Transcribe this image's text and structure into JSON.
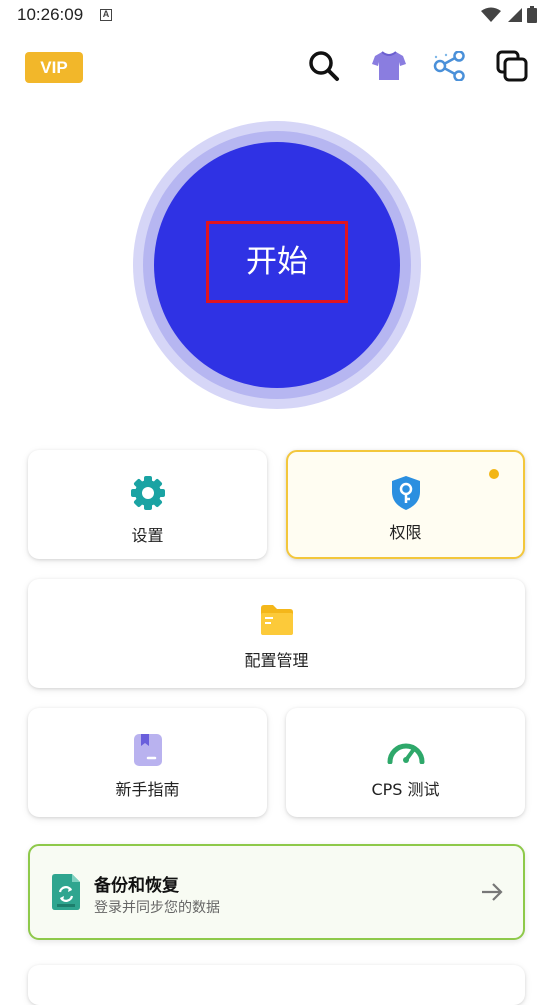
{
  "status_bar": {
    "time": "10:26:09",
    "notification": "A",
    "icons": [
      "wifi-icon",
      "signal-icon",
      "battery-icon"
    ]
  },
  "header": {
    "vip_label": "VIP",
    "icons": [
      "search-icon",
      "theme-shirt-icon",
      "share-icon",
      "copy-windows-icon"
    ]
  },
  "start_button": {
    "label": "开始",
    "color": "#2f32e4"
  },
  "tiles": {
    "settings": {
      "label": "设置",
      "icon": "gear-icon"
    },
    "permissions": {
      "label": "权限",
      "icon": "shield-key-icon"
    },
    "config": {
      "label": "配置管理",
      "icon": "folder-icon"
    },
    "guide": {
      "label": "新手指南",
      "icon": "book-icon"
    },
    "cps": {
      "label": "CPS 测试",
      "icon": "speedometer-icon"
    }
  },
  "backup": {
    "title": "备份和恢复",
    "subtitle": "登录并同步您的数据",
    "icon": "sync-document-icon",
    "arrow_icon": "arrow-right-icon"
  },
  "colors": {
    "vip": "#f2b72a",
    "accent_blue": "#2f32e4",
    "permission_border": "#f3c73c",
    "backup_border": "#8ec94a"
  }
}
